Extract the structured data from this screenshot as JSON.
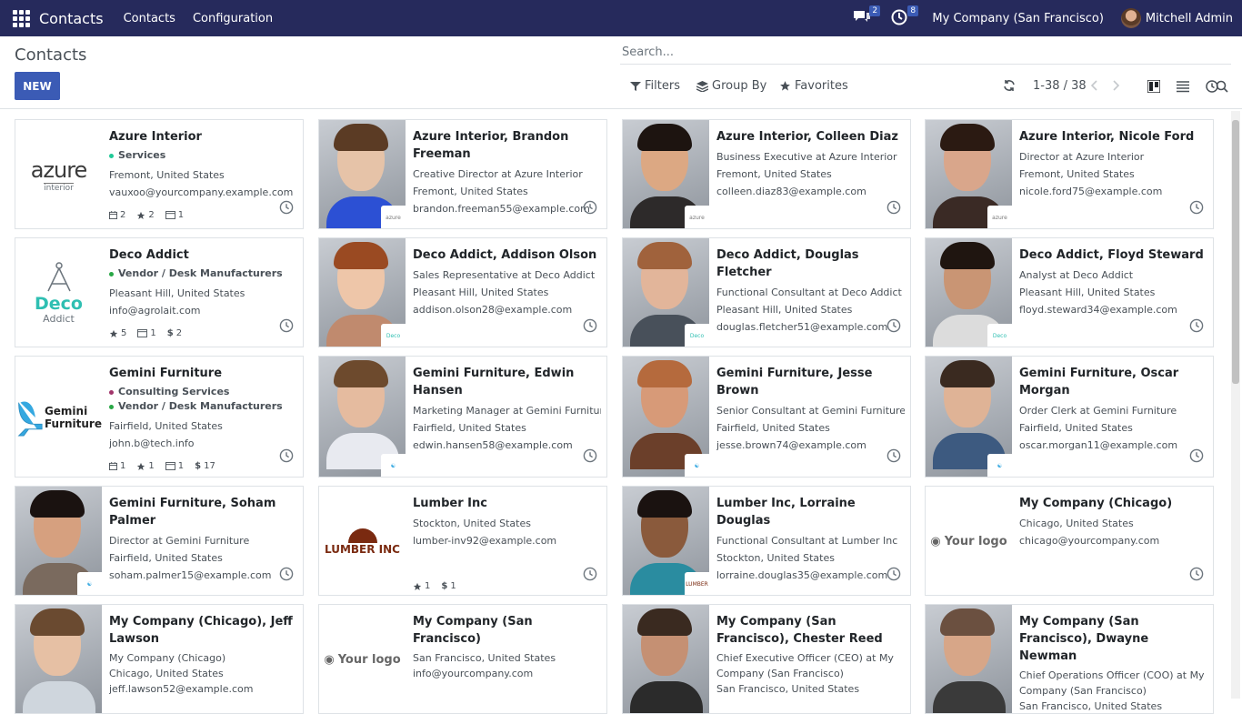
{
  "nav": {
    "brand": "Contacts",
    "links": [
      "Contacts",
      "Configuration"
    ],
    "messages_count": "2",
    "activities_count": "8",
    "company": "My Company (San Francisco)",
    "user": "Mitchell Admin"
  },
  "control": {
    "title": "Contacts",
    "new_label": "NEW",
    "search_placeholder": "Search...",
    "filters": "Filters",
    "group_by": "Group By",
    "favorites": "Favorites",
    "pager": "1-38 / 38"
  },
  "colors": {
    "navbar": "#262a5c",
    "primary": "#3b5bb5"
  },
  "cards": [
    {
      "name": "Azure Interior",
      "tags": [
        {
          "label": "Services",
          "color": "#20c997"
        }
      ],
      "lines": [
        "Fremont, United States",
        "vauxoo@yourcompany.example.com"
      ],
      "stats": [
        "2",
        "2",
        "1"
      ],
      "logo": "azure"
    },
    {
      "name": "Azure Interior, Brandon Freeman",
      "lines": [
        "Creative Director at Azure Interior",
        "Fremont, United States",
        "brandon.freeman55@example.com"
      ],
      "face": "#e6c3a8",
      "hair": "#5b3b24",
      "shirt": "#2c50d4",
      "mini": "azure"
    },
    {
      "name": "Azure Interior, Colleen Diaz",
      "lines": [
        "Business Executive at Azure Interior",
        "Fremont, United States",
        "colleen.diaz83@example.com"
      ],
      "face": "#dca883",
      "hair": "#1d1410",
      "shirt": "#2d2a2a",
      "mini": "azure"
    },
    {
      "name": "Azure Interior, Nicole Ford",
      "lines": [
        "Director at Azure Interior",
        "Fremont, United States",
        "nicole.ford75@example.com"
      ],
      "face": "#d9a68b",
      "hair": "#2b1a12",
      "shirt": "#3a2a25",
      "mini": "azure"
    },
    {
      "name": "Deco Addict",
      "tags": [
        {
          "label": "Vendor / Desk Manufacturers",
          "color": "#28a745"
        }
      ],
      "lines": [
        "Pleasant Hill, United States",
        "info@agrolait.com"
      ],
      "stats": [
        "5",
        "1",
        "2"
      ],
      "logo": "deco"
    },
    {
      "name": "Deco Addict, Addison Olson",
      "lines": [
        "Sales Representative at Deco Addict",
        "Pleasant Hill, United States",
        "addison.olson28@example.com"
      ],
      "face": "#eec6a9",
      "hair": "#9a4a22",
      "shirt": "#c08a6e",
      "mini": "deco"
    },
    {
      "name": "Deco Addict, Douglas Fletcher",
      "lines": [
        "Functional Consultant at Deco Addict",
        "Pleasant Hill, United States",
        "douglas.fletcher51@example.com"
      ],
      "face": "#e2b59a",
      "hair": "#a0623c",
      "shirt": "#48505a",
      "mini": "deco"
    },
    {
      "name": "Deco Addict, Floyd Steward",
      "lines": [
        "Analyst at Deco Addict",
        "Pleasant Hill, United States",
        "floyd.steward34@example.com"
      ],
      "face": "#c99574",
      "hair": "#1f1510",
      "shirt": "#dcdcdc",
      "mini": "deco"
    },
    {
      "name": "Gemini Furniture",
      "tags": [
        {
          "label": "Consulting Services",
          "color": "#a1356b"
        },
        {
          "label": "Vendor / Desk Manufacturers",
          "color": "#28a745"
        }
      ],
      "lines": [
        "Fairfield, United States",
        "john.b@tech.info"
      ],
      "stats": [
        "1",
        "1",
        "1",
        "17"
      ],
      "logo": "gemini"
    },
    {
      "name": "Gemini Furniture, Edwin Hansen",
      "lines": [
        "Marketing Manager at Gemini Furniture",
        "Fairfield, United States",
        "edwin.hansen58@example.com"
      ],
      "face": "#e5bb9f",
      "hair": "#6d4a2d",
      "shirt": "#e8eaf0",
      "mini": "gemini"
    },
    {
      "name": "Gemini Furniture, Jesse Brown",
      "lines": [
        "Senior Consultant at Gemini Furniture",
        "Fairfield, United States",
        "jesse.brown74@example.com"
      ],
      "face": "#d79a78",
      "hair": "#b56a3d",
      "shirt": "#6b3f2a",
      "mini": "gemini"
    },
    {
      "name": "Gemini Furniture, Oscar Morgan",
      "lines": [
        "Order Clerk at Gemini Furniture",
        "Fairfield, United States",
        "oscar.morgan11@example.com"
      ],
      "face": "#dfb396",
      "hair": "#3a2a20",
      "shirt": "#3d5a80",
      "mini": "gemini"
    },
    {
      "name": "Gemini Furniture, Soham Palmer",
      "lines": [
        "Director at Gemini Furniture",
        "Fairfield, United States",
        "soham.palmer15@example.com"
      ],
      "face": "#d6a07f",
      "hair": "#1a1210",
      "shirt": "#7a6a5e",
      "mini": "gemini"
    },
    {
      "name": "Lumber Inc",
      "lines": [
        "Stockton, United States",
        "lumber-inv92@example.com"
      ],
      "stats": [
        "1",
        "1"
      ],
      "logo": "lumber"
    },
    {
      "name": "Lumber Inc, Lorraine Douglas",
      "lines": [
        "Functional Consultant at Lumber Inc",
        "Stockton, United States",
        "lorraine.douglas35@example.com"
      ],
      "face": "#8a5a3c",
      "hair": "#1a1210",
      "shirt": "#2a8ca0",
      "mini": "lumber"
    },
    {
      "name": "My Company (Chicago)",
      "lines": [
        "Chicago, United States",
        "chicago@yourcompany.com"
      ],
      "logo": "yourlogo"
    },
    {
      "name": "My Company (Chicago), Jeff Lawson",
      "lines": [
        "My Company (Chicago)",
        "Chicago, United States",
        "jeff.lawson52@example.com"
      ],
      "face": "#e6c0a4",
      "hair": "#6a4a30",
      "shirt": "#cfd6dd"
    },
    {
      "name": "My Company (San Francisco)",
      "lines": [
        "San Francisco, United States",
        "info@yourcompany.com"
      ],
      "logo": "yourlogo"
    },
    {
      "name": "My Company (San Francisco), Chester Reed",
      "lines": [
        "Chief Executive Officer (CEO) at My Company (San Francisco)",
        "San Francisco, United States"
      ],
      "face": "#c59073",
      "hair": "#3a2a20",
      "shirt": "#2b2b2b"
    },
    {
      "name": "My Company (San Francisco), Dwayne Newman",
      "lines": [
        "Chief Operations Officer (COO) at My Company (San Francisco)",
        "San Francisco, United States"
      ],
      "face": "#d7a688",
      "hair": "#6b5040",
      "shirt": "#3a3a3a"
    }
  ]
}
